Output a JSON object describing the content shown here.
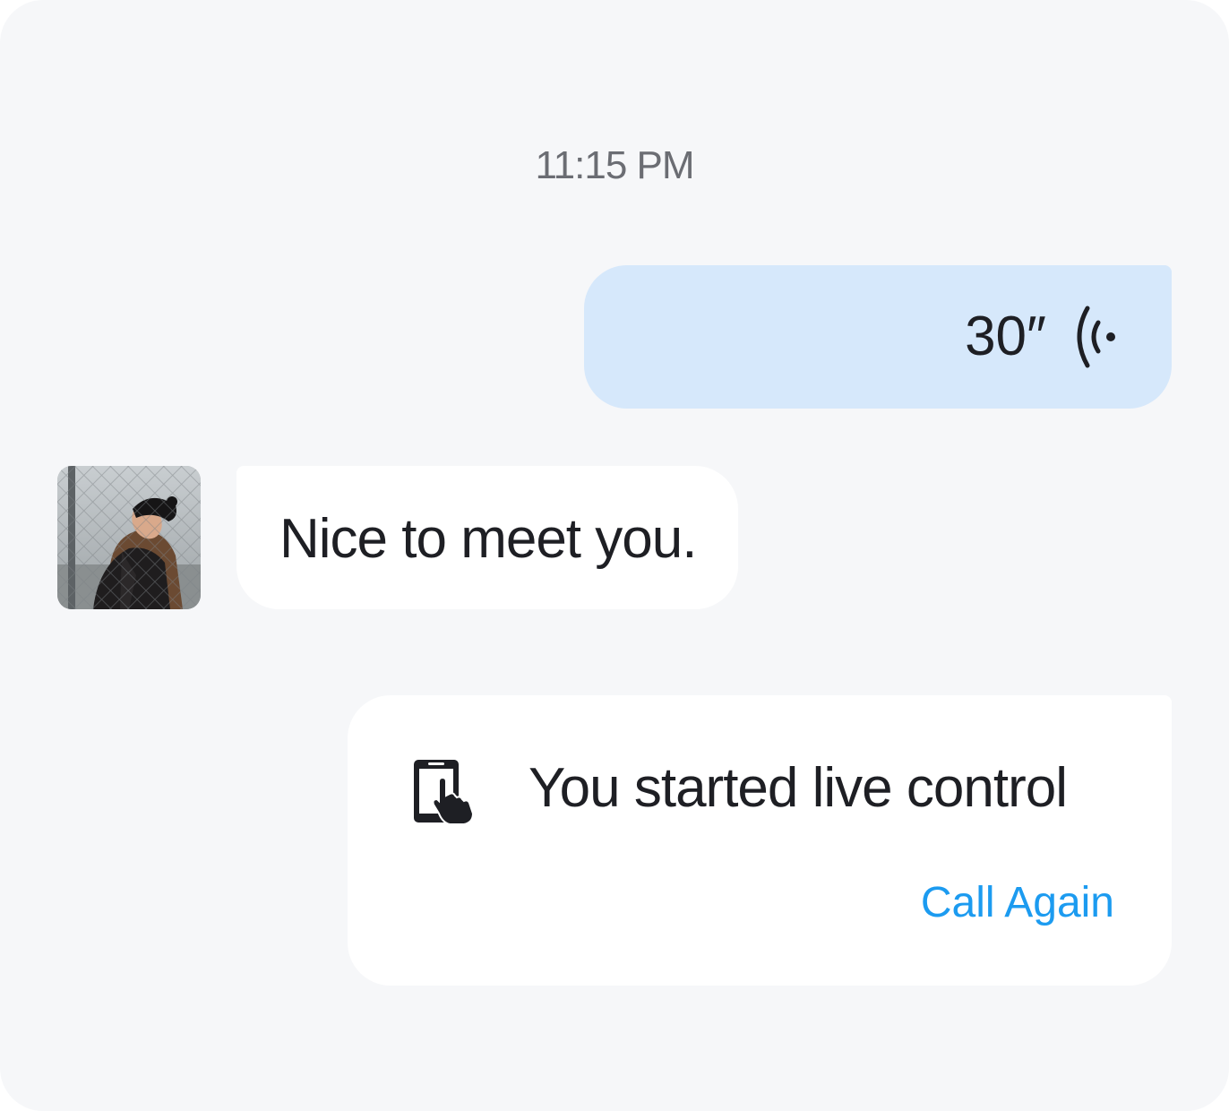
{
  "chat": {
    "timestamp": "11:15 PM",
    "messages": [
      {
        "type": "voice",
        "direction": "outgoing",
        "duration": "30″",
        "icon": "voice-wave-icon",
        "bubble_color": "#d6e8fb"
      },
      {
        "type": "text",
        "direction": "incoming",
        "text": "Nice to meet you.",
        "avatar": "user-avatar-photo"
      },
      {
        "type": "event",
        "direction": "outgoing",
        "icon": "tablet-touch-icon",
        "text": "You started live control",
        "action_label": "Call Again",
        "action_color": "#1c9bf0"
      }
    ]
  }
}
